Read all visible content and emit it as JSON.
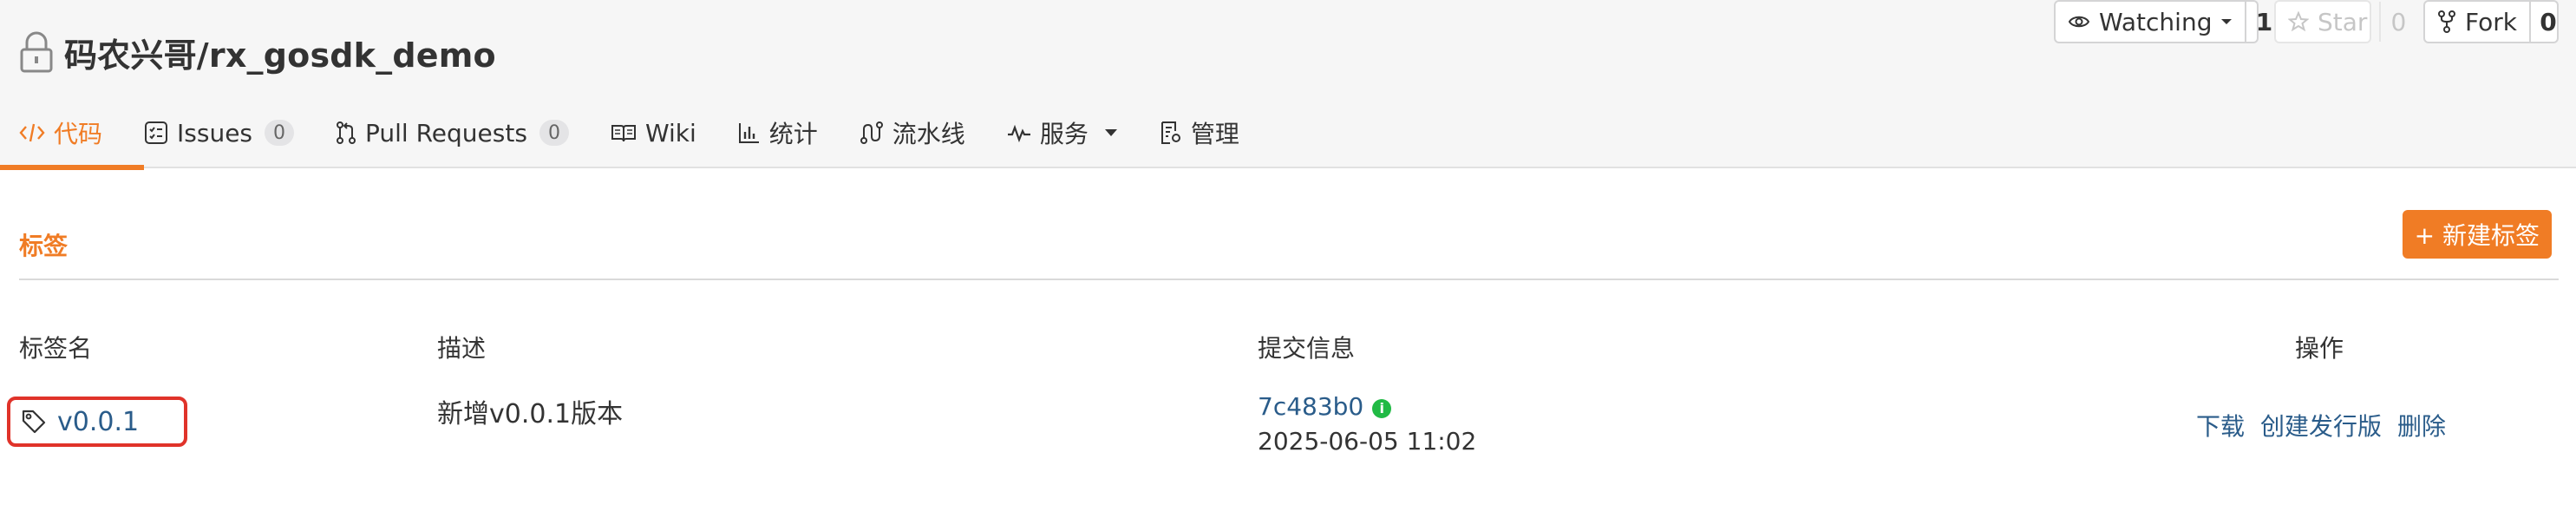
{
  "repo": {
    "name": "码农兴哥/rx_gosdk_demo"
  },
  "actions": {
    "watch": {
      "label": "Watching",
      "count": "1"
    },
    "star": {
      "label": "Star",
      "count": "0"
    },
    "fork": {
      "label": "Fork",
      "count": "0"
    }
  },
  "tabs": [
    {
      "label": "代码",
      "badge": null,
      "active": true
    },
    {
      "label": "Issues",
      "badge": "0"
    },
    {
      "label": "Pull Requests",
      "badge": "0"
    },
    {
      "label": "Wiki"
    },
    {
      "label": "统计"
    },
    {
      "label": "流水线"
    },
    {
      "label": "服务"
    },
    {
      "label": "管理"
    }
  ],
  "section": {
    "title": "标签",
    "new_button": "+ 新建标签"
  },
  "table": {
    "headers": {
      "name": "标签名",
      "desc": "描述",
      "commit": "提交信息",
      "ops": "操作"
    },
    "rows": [
      {
        "tag": "v0.0.1",
        "desc": "新增v0.0.1版本",
        "sha": "7c483b0",
        "date": "2025-06-05 11:02",
        "ops": [
          "下载",
          "创建发行版",
          "删除"
        ]
      }
    ]
  },
  "colors": {
    "accent": "#f07c25",
    "link": "#2a5c8a",
    "highlight_border": "#e0332a",
    "info_green": "#21ba45"
  },
  "icons": {
    "repo": "lock-icon",
    "watch": "eye-icon",
    "star": "star-icon",
    "fork": "fork-icon",
    "code": "code-icon",
    "issues": "issues-icon",
    "pulls": "pull-request-icon",
    "wiki": "book-icon",
    "stats": "bar-chart-icon",
    "pipeline": "pipeline-icon",
    "services": "pulse-icon",
    "manage": "settings-doc-icon",
    "tag": "tag-icon",
    "info": "info-icon"
  }
}
